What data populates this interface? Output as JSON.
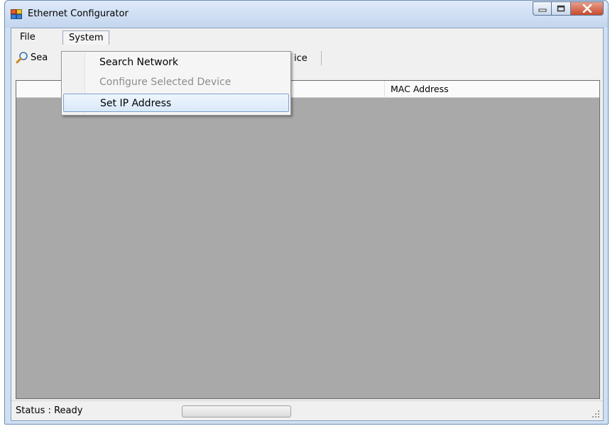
{
  "window": {
    "title": "Ethernet Configurator"
  },
  "menubar": {
    "file": "File",
    "system": "System"
  },
  "system_menu": {
    "items": [
      {
        "label": "Search Network",
        "enabled": true
      },
      {
        "label": "Configure Selected Device",
        "enabled": false
      },
      {
        "label": "Set IP Address",
        "enabled": true,
        "highlighted": true
      }
    ]
  },
  "toolbar": {
    "search_label_visible": "Sea",
    "configure_label_visible": "ice"
  },
  "listview": {
    "columns": [
      "",
      "MAC Address"
    ]
  },
  "statusbar": {
    "status": "Status : Ready"
  },
  "icons": {
    "app": "app-window-icon",
    "search": "magnifier-icon"
  },
  "colors": {
    "highlight_border": "#7da2ce",
    "list_background": "#a9a9a9",
    "close_button": "#c74a2d"
  }
}
